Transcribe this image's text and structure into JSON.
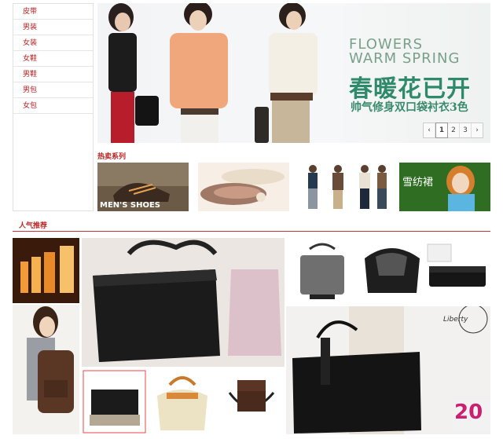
{
  "sidebar": {
    "items": [
      "皮带",
      "男装",
      "女装",
      "女鞋",
      "男鞋",
      "男包",
      "女包"
    ]
  },
  "hero": {
    "title_en_line1": "FLOWERS",
    "title_en_line2": "WARM SPRING",
    "title_cn": "春暖花已开",
    "subtitle_cn": "帅气修身双口袋衬衣3色",
    "pager": {
      "prev": "‹",
      "pages": [
        "1",
        "2",
        "3"
      ],
      "next": "›",
      "active": "1"
    }
  },
  "hot": {
    "label": "热卖系列",
    "thumbs": [
      {
        "name": "mens-shoes",
        "caption": "MEN'S SHOES"
      },
      {
        "name": "womens-flats",
        "caption": ""
      },
      {
        "name": "mens-fashion",
        "caption": ""
      },
      {
        "name": "snow-chiffon",
        "caption": "雪纺裙"
      }
    ]
  },
  "recommend": {
    "label": "人气推荐",
    "tile_captions": {
      "liberty": "Liberty",
      "promo_corner": "20"
    }
  },
  "colors": {
    "accent": "#b22222",
    "hero_green": "#2e8a6a"
  }
}
